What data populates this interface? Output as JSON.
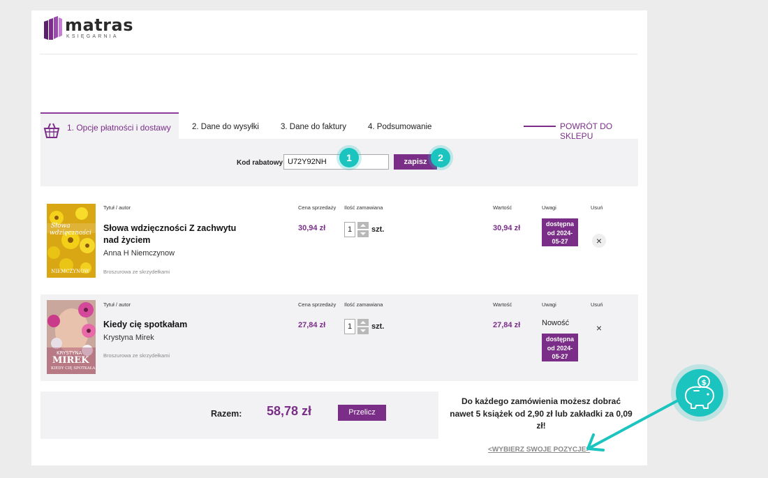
{
  "brand": {
    "name": "matras",
    "sub": "KSIĘGARNIA",
    "color": "#7a2e88"
  },
  "steps": {
    "s1": "1. Opcje płatności i dostawy",
    "s2": "2. Dane do wysyłki",
    "s3": "3. Dane do faktury",
    "s4": "4. Podsumowanie",
    "back": "POWRÓT DO SKLEPU"
  },
  "discount": {
    "label": "Kod rabatowy",
    "value": "U72Y92NH",
    "save": "zapisz",
    "badge1": "1",
    "badge2": "2"
  },
  "headers": {
    "title_author": "Tytuł / autor",
    "price": "Cena sprzedaży",
    "qty": "Ilość zamawiana",
    "value": "Wartość",
    "notes": "Uwagi",
    "remove": "Usuń"
  },
  "items": [
    {
      "title": "Słowa wdzięczności Z zachwytu nad życiem",
      "author": "Anna H Niemczynow",
      "format": "Broszurowa ze skrzydełkami",
      "price": "30,94 zł",
      "qty": "1",
      "unit": "szt.",
      "value": "30,94 zł",
      "availability": [
        "dostępna",
        "od 2024-",
        "05-27"
      ],
      "remove": "×"
    },
    {
      "title": "Kiedy cię spotkałam",
      "author": "Krystyna Mirek",
      "format": "Broszurowa ze skrzydełkami",
      "price": "27,84 zł",
      "qty": "1",
      "unit": "szt.",
      "value": "27,84 zł",
      "note": "Nowość",
      "availability": [
        "dostępna",
        "od 2024-",
        "05-27"
      ],
      "remove": "×"
    }
  ],
  "summary": {
    "label": "Razem:",
    "total": "58,78 zł",
    "recalc": "Przelicz"
  },
  "promo": {
    "line1": "Do każdego zamówienia możesz dobrać",
    "line2": "nawet 5 książek od 2,90 zł lub zakładki za 0,09",
    "line3": "zł!",
    "link": "<WYBIERZ SWOJE POZYCJE>"
  }
}
